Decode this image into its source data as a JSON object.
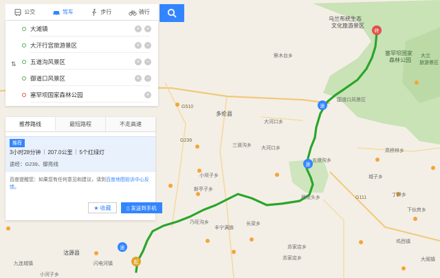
{
  "transport": {
    "modes": [
      {
        "label": "公交",
        "icon": "bus-icon"
      },
      {
        "label": "驾车",
        "icon": "car-icon"
      },
      {
        "label": "步行",
        "icon": "walk-icon"
      },
      {
        "label": "骑行",
        "icon": "bike-icon"
      }
    ],
    "active": "驾车"
  },
  "waypoints": [
    {
      "name": "大滩镇"
    },
    {
      "name": "大汗行宫旅游景区"
    },
    {
      "name": "五道沟风景区"
    },
    {
      "name": "御道口风景区"
    },
    {
      "name": "塞罕坝国家森林公园"
    }
  ],
  "tabs": [
    {
      "label": "推荐路线"
    },
    {
      "label": "最短路程"
    },
    {
      "label": "不走高速"
    }
  ],
  "route": {
    "badge": "推荐",
    "time": "3小时28分钟",
    "distance": "207.0公里",
    "lights": "5个红绿灯",
    "via": "途经：G239、御亮线"
  },
  "feedback": {
    "prefix": "百度提醒您：如果您有任何意见和建议，请到",
    "link": "百度地图投诉中心反馈",
    "suffix": "。"
  },
  "actions": {
    "save": "收藏",
    "send": "发送到手机"
  },
  "map": {
    "labels": [
      {
        "text": "乌兰布统生态",
        "cls": "big"
      },
      {
        "text": "文化旅游景区",
        "cls": "big"
      },
      {
        "text": "塞罕坝国家",
        "cls": "big green"
      },
      {
        "text": "森林公园",
        "cls": "big green"
      },
      {
        "text": "大兰",
        "cls": "green"
      },
      {
        "text": "旅游景区",
        "cls": "green"
      },
      {
        "text": "国道口风景区",
        "cls": ""
      },
      {
        "text": "察木台乡",
        "cls": ""
      },
      {
        "text": "多伦县",
        "cls": "big"
      },
      {
        "text": "大河口乡",
        "cls": ""
      },
      {
        "text": "三道沟乡",
        "cls": ""
      },
      {
        "text": "五道沟乡",
        "cls": ""
      },
      {
        "text": "小坝子乡",
        "cls": ""
      },
      {
        "text": "新亭子乡",
        "cls": ""
      },
      {
        "text": "西龙头乡",
        "cls": ""
      },
      {
        "text": "丁辟乡",
        "cls": ""
      },
      {
        "text": "城子乡",
        "cls": ""
      },
      {
        "text": "乃旺沟乡",
        "cls": ""
      },
      {
        "text": "丰宁满族",
        "cls": ""
      },
      {
        "text": "沽源县",
        "cls": "big"
      },
      {
        "text": "九连城镇",
        "cls": ""
      },
      {
        "text": "闪电河镇",
        "cls": ""
      },
      {
        "text": "长梁乡",
        "cls": ""
      },
      {
        "text": "苏家店乡",
        "cls": ""
      },
      {
        "text": "小河子乡",
        "cls": ""
      },
      {
        "text": "G510",
        "cls": "road"
      },
      {
        "text": "G239",
        "cls": "road"
      },
      {
        "text": "G111",
        "cls": "road"
      },
      {
        "text": "高桥林乡",
        "cls": ""
      },
      {
        "text": "下伙房乡",
        "cls": ""
      },
      {
        "text": "大河口乡",
        "cls": ""
      },
      {
        "text": "鸡西镇",
        "cls": ""
      },
      {
        "text": "苏家店乡",
        "cls": ""
      },
      {
        "text": "大阁镇",
        "cls": ""
      }
    ]
  },
  "colors": {
    "accent": "#3385ff",
    "route": "#2aa52a",
    "forest": "#c9e2b6"
  }
}
